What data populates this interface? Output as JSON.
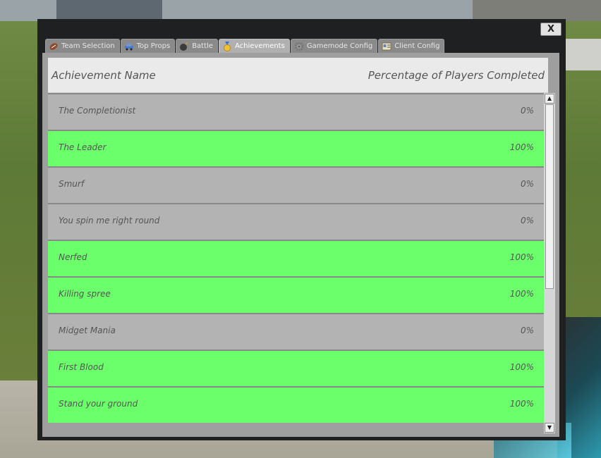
{
  "window": {
    "close_label": "X",
    "tabs": [
      {
        "label": "Team Selection",
        "icon": "football-icon"
      },
      {
        "label": "Top Props",
        "icon": "car-icon"
      },
      {
        "label": "Battle",
        "icon": "bomb-icon"
      },
      {
        "label": "Achievements",
        "icon": "medal-icon"
      },
      {
        "label": "Gamemode Config",
        "icon": "gear-icon"
      },
      {
        "label": "Client Config",
        "icon": "id-card-icon"
      }
    ],
    "active_tab": "Achievements"
  },
  "table": {
    "header_name": "Achievement Name",
    "header_percent": "Percentage of Players Completed",
    "rows": [
      {
        "name": "The Completionist",
        "percent": "0%"
      },
      {
        "name": "The Leader",
        "percent": "100%"
      },
      {
        "name": "Smurf",
        "percent": "0%"
      },
      {
        "name": "You spin me right round",
        "percent": "0%"
      },
      {
        "name": "Nerfed",
        "percent": "100%"
      },
      {
        "name": "Killing spree",
        "percent": "100%"
      },
      {
        "name": "Midget Mania",
        "percent": "0%"
      },
      {
        "name": "First Blood",
        "percent": "100%"
      },
      {
        "name": "Stand your ground",
        "percent": "100%"
      }
    ]
  },
  "colors": {
    "completed_row": "#6bff6b",
    "incomplete_row": "#b3b3b3"
  }
}
